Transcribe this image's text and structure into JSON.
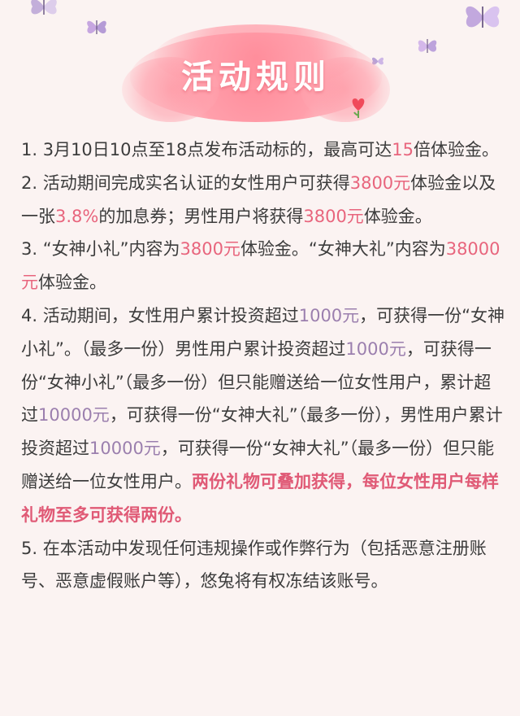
{
  "title": "活动规则",
  "rules": [
    {
      "segments": [
        {
          "text": "1.  3月10日10点至18点发布活动标的，最高可达",
          "style": "normal"
        },
        {
          "text": "15",
          "style": "red"
        },
        {
          "text": "倍体验金。",
          "style": "normal"
        }
      ]
    },
    {
      "segments": [
        {
          "text": "2.  活动期间完成实名认证的女性用户可获得",
          "style": "normal"
        },
        {
          "text": "3800元",
          "style": "red"
        },
        {
          "text": "体验金以及一张",
          "style": "normal"
        },
        {
          "text": "3.8%",
          "style": "red"
        },
        {
          "text": "的加息券；男性用户将获得",
          "style": "normal"
        },
        {
          "text": "3800元",
          "style": "red"
        },
        {
          "text": "体验金。",
          "style": "normal"
        }
      ]
    },
    {
      "segments": [
        {
          "text": "3.  “女神小礼”内容为",
          "style": "normal"
        },
        {
          "text": "3800元",
          "style": "red"
        },
        {
          "text": "体验金。“女神大礼”内容为",
          "style": "normal"
        },
        {
          "text": "38000元",
          "style": "red"
        },
        {
          "text": "体验金。",
          "style": "normal"
        }
      ]
    },
    {
      "segments": [
        {
          "text": "4.  活动期间，女性用户累计投资超过",
          "style": "normal"
        },
        {
          "text": "1000元",
          "style": "purple"
        },
        {
          "text": "，可获得一份“女神小礼”。（最多一份）男性用户累计投资超过",
          "style": "normal"
        },
        {
          "text": "1000元",
          "style": "purple"
        },
        {
          "text": "，可获得一份“女神小礼”（最多一份）但只能赠送给一位女性用户，累计超过",
          "style": "normal"
        },
        {
          "text": "10000元",
          "style": "purple"
        },
        {
          "text": "，可获得一份“女神大礼”（最多一份），男性用户累计投资超过",
          "style": "normal"
        },
        {
          "text": "10000元",
          "style": "purple"
        },
        {
          "text": "，可获得一份“女神大礼”（最多一份）但只能赠送给一位女性用户。",
          "style": "normal"
        },
        {
          "text": "两份礼物可叠加获得，每位女性用户每样礼物至多可获得两份。",
          "style": "bold"
        }
      ]
    },
    {
      "segments": [
        {
          "text": "5. 在本活动中发现任何违规操作或作弊行为（包括恶意注册账号、恶意虚假账户等），悠兔将有权冻结该账号。",
          "style": "normal"
        }
      ]
    }
  ],
  "decorations": [
    {
      "icon": "butterfly-icon",
      "color": "#b9a2d6"
    },
    {
      "icon": "butterfly-icon",
      "color": "#c6a6e0"
    },
    {
      "icon": "butterfly-icon",
      "color": "#c2a8de"
    },
    {
      "icon": "butterfly-icon",
      "color": "#d4b8ea"
    },
    {
      "icon": "butterfly-icon",
      "color": "#b9a2d6"
    },
    {
      "icon": "heart-icon",
      "color": "#f04a5a"
    }
  ],
  "colors": {
    "background": "#fbf3f2",
    "text": "#3c3c3c",
    "highlight_red": "#e8657d",
    "highlight_purple": "#9b7fae",
    "banner_pink": "#ff9fab"
  }
}
